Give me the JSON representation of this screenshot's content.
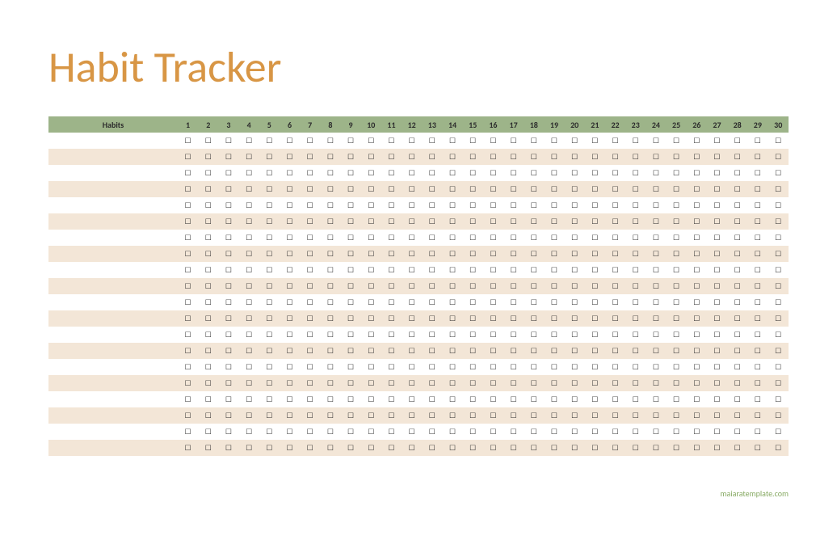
{
  "title": "Habit Tracker",
  "header": {
    "habits_label": "Habits",
    "days": [
      "1",
      "2",
      "3",
      "4",
      "5",
      "6",
      "7",
      "8",
      "9",
      "10",
      "11",
      "12",
      "13",
      "14",
      "15",
      "16",
      "17",
      "18",
      "19",
      "20",
      "21",
      "22",
      "23",
      "24",
      "25",
      "26",
      "27",
      "28",
      "29",
      "30"
    ]
  },
  "checkbox_glyph": "☐",
  "row_count": 20,
  "footer": "maiaratemplate.com",
  "colors": {
    "title": "#d89645",
    "header_bg": "#9db489",
    "row_alt_bg": "#f3e6d7",
    "footer_text": "#86a962"
  }
}
